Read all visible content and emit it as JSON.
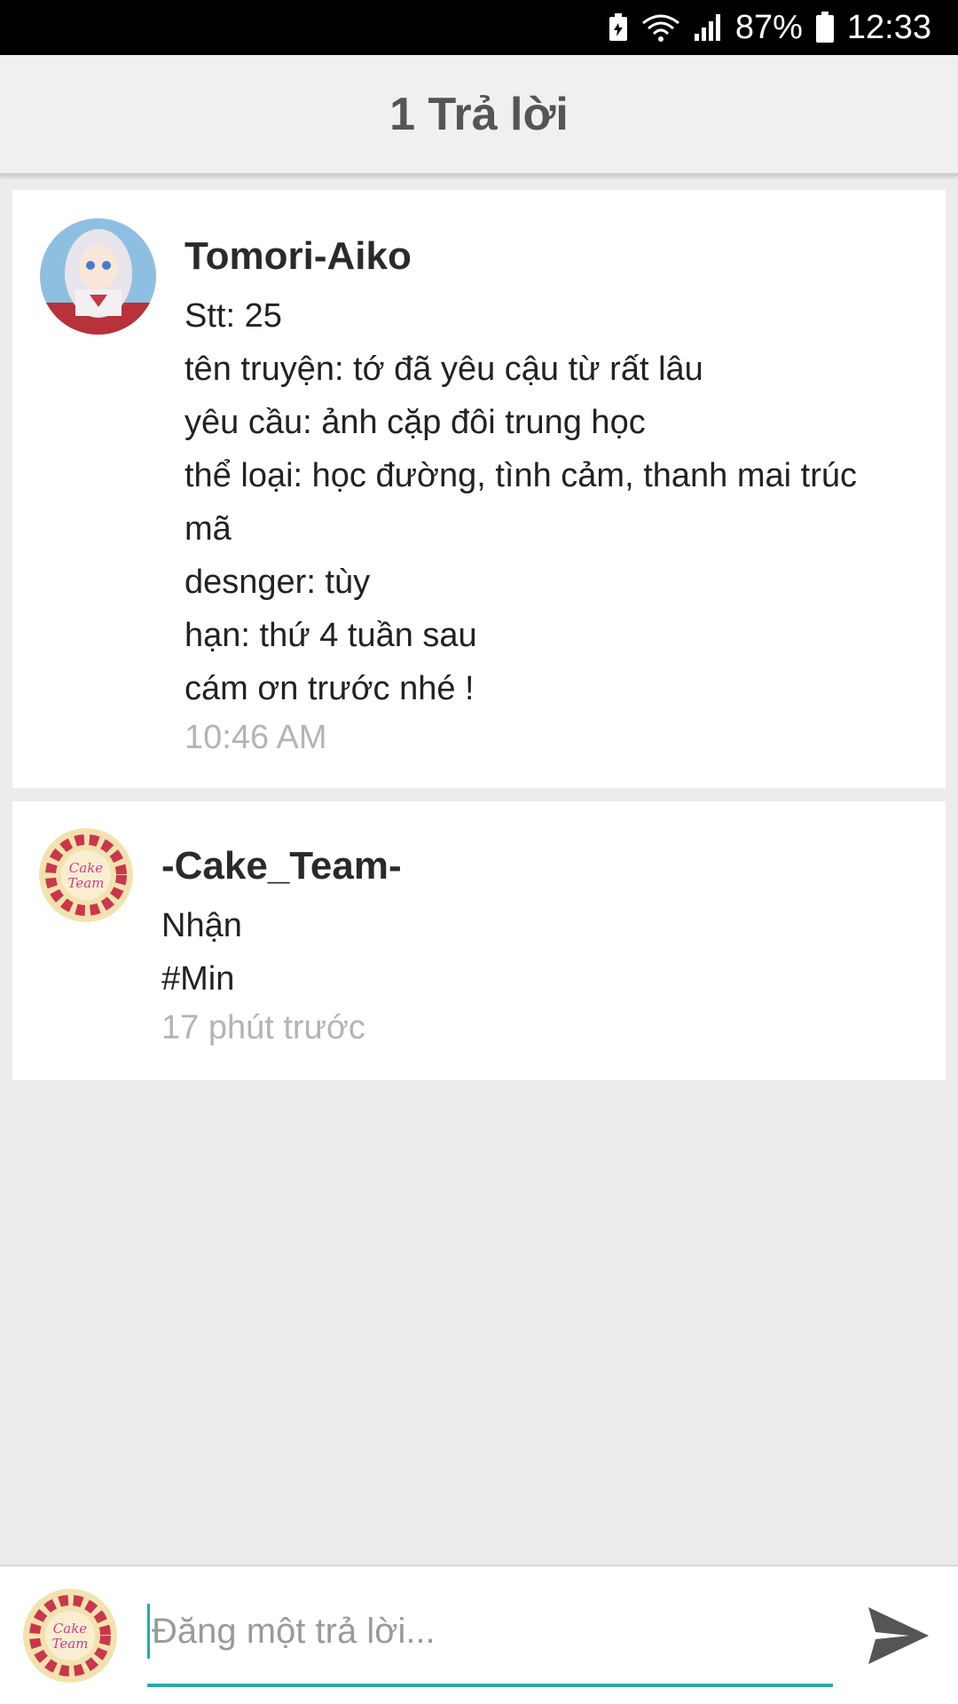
{
  "status_bar": {
    "battery_percent": "87%",
    "time": "12:33",
    "icons": [
      "battery-saver-icon",
      "wifi-icon",
      "signal-icon",
      "battery-icon"
    ]
  },
  "header": {
    "title": "1 Trả lời"
  },
  "posts": [
    {
      "author": "Tomori-Aiko",
      "avatar_icon": "anime-girl-avatar",
      "lines": [
        "Stt: 25",
        "tên truyện: tớ đã yêu cậu từ rất lâu",
        "yêu cầu: ảnh cặp đôi trung học",
        "thể loại: học đường, tình cảm, thanh mai trúc",
        "mã",
        "desnger: tùy",
        "hạn: thứ 4 tuần sau",
        "cám ơn trước nhé !"
      ],
      "time": "10:46 AM"
    },
    {
      "author": "-Cake_Team-",
      "avatar_icon": "cake-team-avatar",
      "lines": [
        "Nhận",
        "#Min"
      ],
      "time": "17 phút trước"
    }
  ],
  "compose": {
    "placeholder": "Đăng một trả lời...",
    "value": "",
    "avatar_icon": "cake-team-avatar",
    "send_icon": "send-icon"
  },
  "colors": {
    "accent": "#2aa9a5",
    "background": "#ececec",
    "card": "#ffffff",
    "timestamp": "#b4b4b4"
  }
}
